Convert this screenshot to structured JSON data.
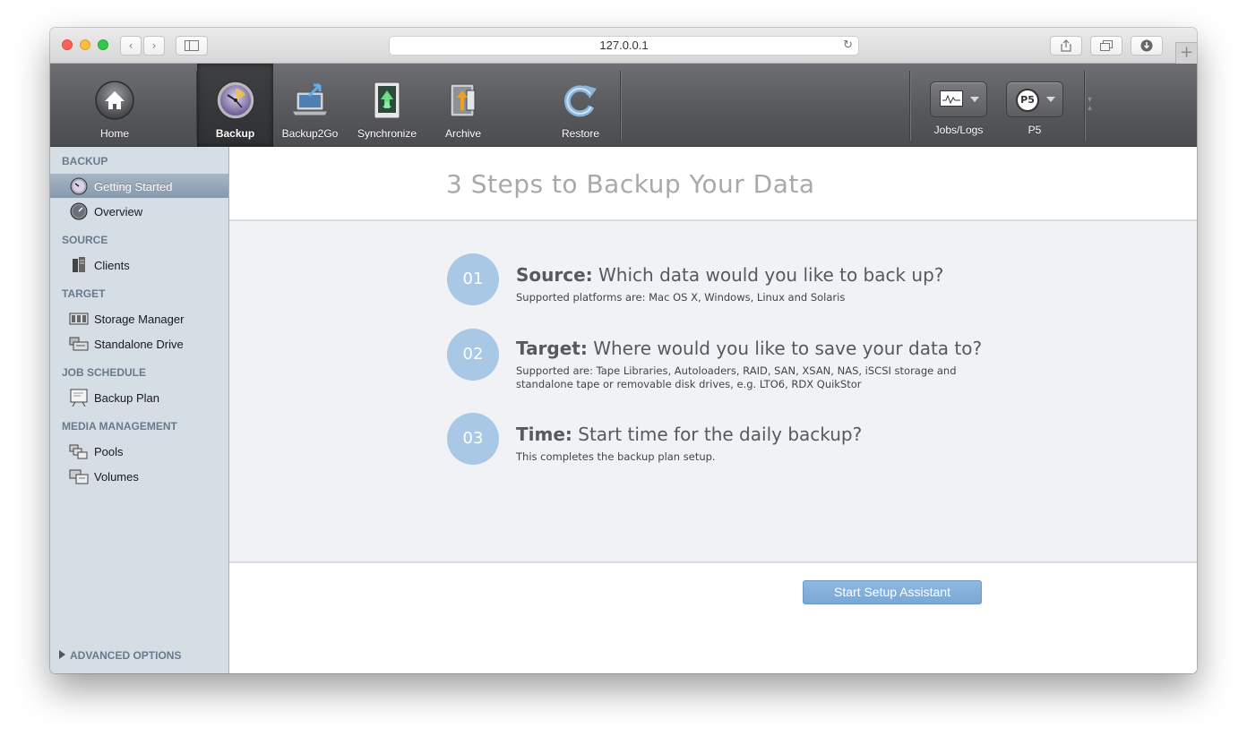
{
  "browser": {
    "url": "127.0.0.1",
    "icons": [
      "back-icon",
      "forward-icon",
      "sidebar-icon",
      "reload-icon",
      "share-icon",
      "tabs-icon",
      "downloads-icon",
      "new-tab-icon"
    ]
  },
  "toolbar": {
    "tools": [
      {
        "label": "Home",
        "icon": "home-icon"
      },
      {
        "label": "Backup",
        "icon": "backup-clock-icon"
      },
      {
        "label": "Backup2Go",
        "icon": "laptop-icon"
      },
      {
        "label": "Synchronize",
        "icon": "sync-icon"
      },
      {
        "label": "Archive",
        "icon": "archive-safe-icon"
      },
      {
        "label": "Restore",
        "icon": "restore-arrow-icon"
      }
    ],
    "jobs_label": "Jobs/Logs",
    "p5_label": "P5",
    "p5_badge": "P5"
  },
  "sidebar": {
    "sections": [
      {
        "title": "BACKUP",
        "items": [
          "Getting Started",
          "Overview"
        ]
      },
      {
        "title": "SOURCE",
        "items": [
          "Clients"
        ]
      },
      {
        "title": "TARGET",
        "items": [
          "Storage Manager",
          "Standalone Drive"
        ]
      },
      {
        "title": "JOB SCHEDULE",
        "items": [
          "Backup Plan"
        ]
      },
      {
        "title": "MEDIA MANAGEMENT",
        "items": [
          "Pools",
          "Volumes"
        ]
      }
    ],
    "selected": "Getting Started",
    "advanced": "ADVANCED OPTIONS"
  },
  "main": {
    "title": "3 Steps to Backup Your Data",
    "steps": [
      {
        "num": "01",
        "keyword": "Source:",
        "question": "Which data would you like to back up?",
        "desc": "Supported platforms are: Mac OS X, Windows, Linux and Solaris"
      },
      {
        "num": "02",
        "keyword": "Target:",
        "question": "Where would you like to save your data to?",
        "desc": "Supported are: Tape Libraries, Autoloaders, RAID, SAN, XSAN, NAS, iSCSI storage and standalone tape or removable disk drives, e.g. LTO6, RDX QuikStor"
      },
      {
        "num": "03",
        "keyword": "Time:",
        "question": "Start time for the daily backup?",
        "desc": "This completes the backup plan setup."
      }
    ],
    "button": "Start Setup Assistant"
  },
  "colors": {
    "accent": "#a8c8e6",
    "button": "#7aa8d4",
    "sidebar_bg": "#d5dde5",
    "toolbar_bg": "#56575a"
  }
}
